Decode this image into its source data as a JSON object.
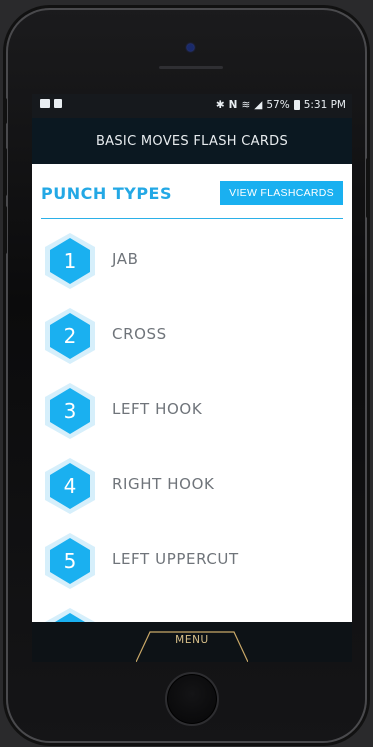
{
  "status_bar": {
    "left_icons": [
      "image-icon",
      "clipboard-icon"
    ],
    "right_icons": [
      "bluetooth-icon",
      "nfc-icon",
      "wifi-icon",
      "signal-icon",
      "battery-icon"
    ],
    "battery": "57%",
    "time": "5:31 PM"
  },
  "header": {
    "title": "BASIC MOVES FLASH CARDS"
  },
  "section": {
    "title": "PUNCH TYPES",
    "button_label": "VIEW FLASHCARDS"
  },
  "punches": [
    {
      "number": "1",
      "label": "JAB"
    },
    {
      "number": "2",
      "label": "CROSS"
    },
    {
      "number": "3",
      "label": "LEFT HOOK"
    },
    {
      "number": "4",
      "label": "RIGHT HOOK"
    },
    {
      "number": "5",
      "label": "LEFT UPPERCUT"
    }
  ],
  "bottom_bar": {
    "menu_label": "MENU"
  },
  "colors": {
    "accent": "#1ab0f0",
    "title_bar": "#0b1821",
    "menu_text": "#d8c08a",
    "label": "#6f747a"
  }
}
